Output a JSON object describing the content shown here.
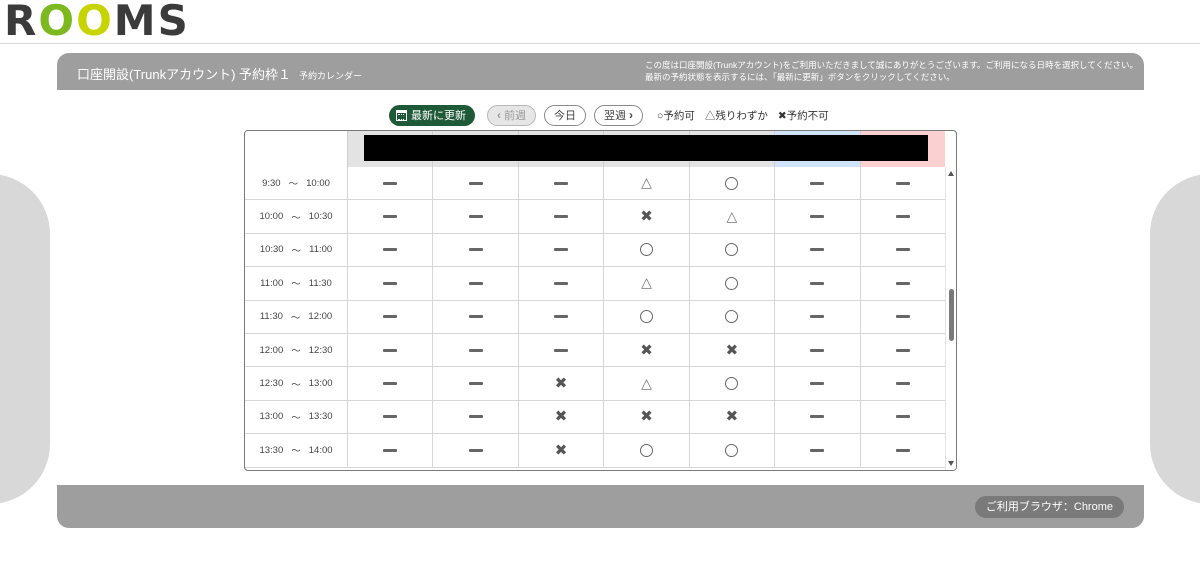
{
  "logo": {
    "r": "R",
    "o1": "O",
    "o2": "O",
    "ms": "MS"
  },
  "panel": {
    "title": "口座開設(Trunkアカウント)  予約枠１",
    "subtitle": "予約カレンダー",
    "message_line1": "この度は口座開設(Trunkアカウント)をご利用いただきまして誠にありがとうございます。ご利用になる日時を選択してください。",
    "message_line2": "最新の予約状態を表示するには、「最新に更新」ボタンをクリックしてください。"
  },
  "toolbar": {
    "refresh_label": "最新に更新",
    "prev_label": "前週",
    "today_label": "今日",
    "next_label": "翌週",
    "legend": {
      "available": "○予約可",
      "few": "△残りわずか",
      "unavailable": "✖予約不可"
    }
  },
  "footer": {
    "browser_label": "ご利用ブラウザ：Chrome"
  },
  "colors": {
    "refresh_button": "#1f5a38",
    "panel_header": "#9e9e9e",
    "saturday_header": "#cfe3fb",
    "sunday_header": "#fbd0d0"
  },
  "table": {
    "rows": [
      {
        "start": "9:30",
        "sep": "～",
        "end": "10:00",
        "slots": [
          "-",
          "-",
          "-",
          "△",
          "○",
          "-",
          "-"
        ]
      },
      {
        "start": "10:00",
        "sep": "～",
        "end": "10:30",
        "slots": [
          "-",
          "-",
          "-",
          "✖",
          "△",
          "-",
          "-"
        ]
      },
      {
        "start": "10:30",
        "sep": "～",
        "end": "11:00",
        "slots": [
          "-",
          "-",
          "-",
          "○",
          "○",
          "-",
          "-"
        ]
      },
      {
        "start": "11:00",
        "sep": "～",
        "end": "11:30",
        "slots": [
          "-",
          "-",
          "-",
          "△",
          "○",
          "-",
          "-"
        ]
      },
      {
        "start": "11:30",
        "sep": "～",
        "end": "12:00",
        "slots": [
          "-",
          "-",
          "-",
          "○",
          "○",
          "-",
          "-"
        ]
      },
      {
        "start": "12:00",
        "sep": "～",
        "end": "12:30",
        "slots": [
          "-",
          "-",
          "-",
          "✖",
          "✖",
          "-",
          "-"
        ]
      },
      {
        "start": "12:30",
        "sep": "～",
        "end": "13:00",
        "slots": [
          "-",
          "-",
          "✖",
          "△",
          "○",
          "-",
          "-"
        ]
      },
      {
        "start": "13:00",
        "sep": "～",
        "end": "13:30",
        "slots": [
          "-",
          "-",
          "✖",
          "✖",
          "✖",
          "-",
          "-"
        ]
      },
      {
        "start": "13:30",
        "sep": "～",
        "end": "14:00",
        "slots": [
          "-",
          "-",
          "✖",
          "○",
          "○",
          "-",
          "-"
        ]
      }
    ]
  }
}
